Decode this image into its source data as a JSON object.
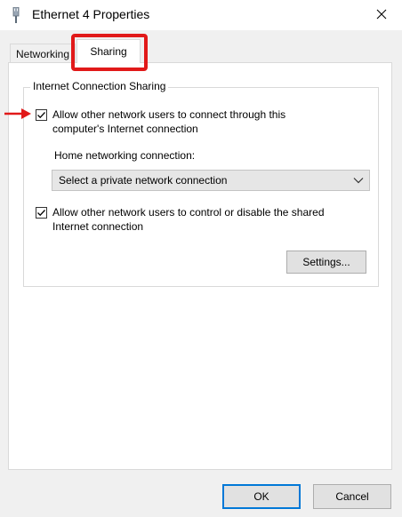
{
  "window": {
    "title": "Ethernet 4 Properties",
    "icon": "network-adapter-icon",
    "close_icon": "close-icon"
  },
  "tabs": [
    {
      "label": "Networking",
      "selected": false
    },
    {
      "label": "Sharing",
      "selected": true
    }
  ],
  "sharing": {
    "group_title": "Internet Connection Sharing",
    "allow_connect": {
      "label": "Allow other network users to connect through this computer's Internet connection",
      "checked": true
    },
    "home_networking_label": "Home networking connection:",
    "home_networking_select": {
      "selected": "Select a private network connection"
    },
    "allow_control": {
      "label": "Allow other network users to control or disable the shared Internet connection",
      "checked": true
    },
    "settings_button": "Settings..."
  },
  "footer": {
    "ok_button": "OK",
    "cancel_button": "Cancel"
  },
  "annotations": {
    "highlight_color": "#e11919",
    "arrow_color": "#e11919"
  }
}
